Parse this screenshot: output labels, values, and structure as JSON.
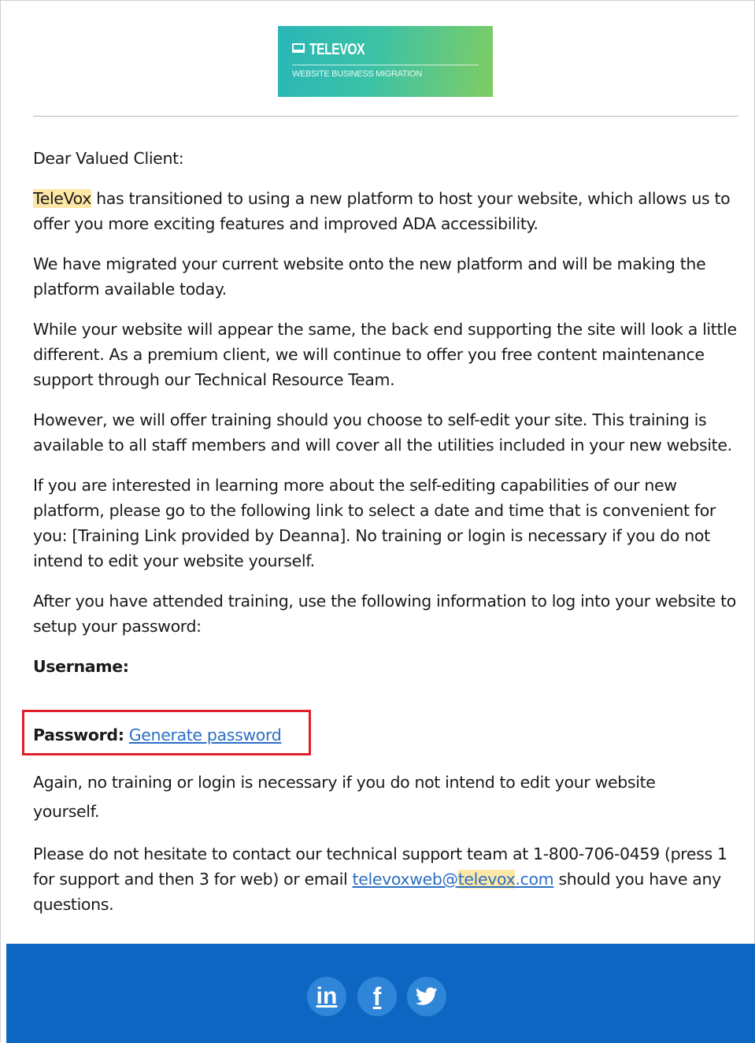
{
  "logo": {
    "title": "TELEVOX",
    "subtitle": "WEBSITE BUSINESS MIGRATION"
  },
  "email": {
    "greeting": "Dear Valued Client:",
    "p1_brand": "TeleVox",
    "p1_rest": " has transitioned to using a new platform to host your website, which allows us to offer you more exciting features and improved ADA accessibility.",
    "p2": "We have migrated your current website onto the new platform and will be making the platform available today.",
    "p3": "While your website will appear the same, the back end supporting the site will look a little different. As a premium client, we will continue to offer you free content maintenance support through our Technical Resource Team.",
    "p4": "However, we will offer training should you choose to self-edit your site. This training is available to all staff members and will cover all the utilities included in your new website.",
    "p5": "If you are interested in learning more about the self-editing capabilities of our new platform, please go to the following link to select a date and time that is convenient for you: [Training Link provided by Deanna]. No training or login is necessary if you do not intend to edit your website yourself.",
    "p6": "After you have attended training, use the following information to log into your website to setup your password:",
    "username_label": "Username:",
    "password_label": "Password:",
    "password_link": "Generate password",
    "again": "Again, no training or login is necessary if you do not intend to edit your website yourself.",
    "contact_pre": "Please do not hesitate to contact our technical support team at 1-800-706-0459 (press 1 for support and then 3 for web) or email ",
    "contact_email_a": "televoxweb@",
    "contact_email_b": "televox",
    "contact_email_c": ".com",
    "contact_post": " should you have any questions."
  },
  "footer": {
    "social": [
      {
        "name": "linkedin-icon",
        "glyph": "in"
      },
      {
        "name": "facebook-icon",
        "glyph": "f"
      },
      {
        "name": "twitter-icon",
        "glyph": "🐦"
      }
    ]
  },
  "colors": {
    "footer_bg": "#0d66c2",
    "highlight_box": "#e01f2b",
    "link": "#2b6fc4",
    "brand_highlight": "#fde7a6"
  }
}
